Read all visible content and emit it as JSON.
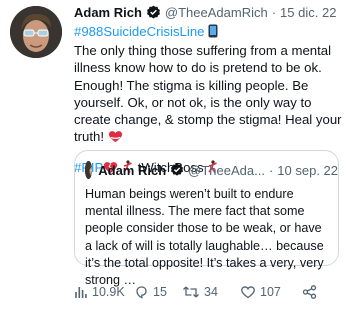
{
  "author": {
    "name": "Adam Rich",
    "handle": "@TheeAdamRich",
    "separator": "·",
    "date": "15 dic. 22"
  },
  "body": {
    "hashtag": "#988SuicideCrisisLine",
    "text": "The only thing those suffering from a mental illness know how to do is pretend to be ok. Enough! The stigma is killing people. Be yourself. Ok, or not ok, is the only way to create change, & stomp the stigma! Heal your truth!",
    "rip_tag": "#RIP",
    "twitch_name": "tWitchBoss"
  },
  "quote": {
    "name": "Adam Rich",
    "handle": "@TheeAda...",
    "separator": "·",
    "date": "10 sep. 22",
    "text": "Human beings weren’t built to endure mental illness. The mere fact that some people consider those to be weak, or have a lack of will is totally laughable… because it’s the total opposite! It’s takes a very, very strong …"
  },
  "actions": {
    "views": "10.9K",
    "replies": "15",
    "retweets": "34",
    "likes": "107"
  },
  "icons": [
    "avatar-photo",
    "verified-icon",
    "phone-emoji",
    "heart-emoji",
    "broken-heart-emoji",
    "dancer-emoji",
    "views-icon",
    "reply-icon",
    "retweet-icon",
    "like-icon",
    "share-icon"
  ],
  "colors": {
    "link": "#1d9bf0",
    "muted": "#536471",
    "text": "#0f1419",
    "border": "#cfd9de"
  }
}
